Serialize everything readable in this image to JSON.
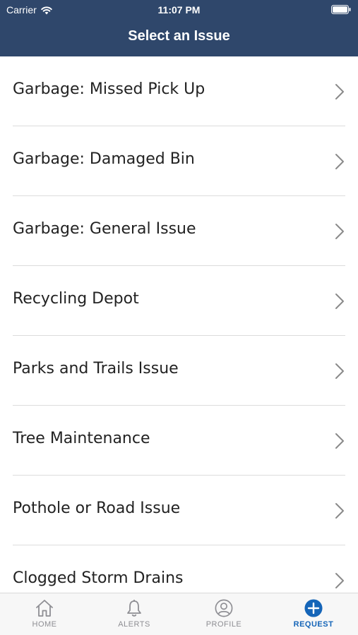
{
  "status_bar": {
    "carrier": "Carrier",
    "time": "11:07 PM"
  },
  "header": {
    "title": "Select an Issue"
  },
  "issues": [
    {
      "label": "Garbage: Missed Pick Up",
      "icon": "chevron-right-icon"
    },
    {
      "label": "Garbage: Damaged Bin",
      "icon": "chevron-right-icon"
    },
    {
      "label": "Garbage: General Issue",
      "icon": "chevron-right-icon"
    },
    {
      "label": "Recycling Depot",
      "icon": "chevron-right-icon"
    },
    {
      "label": "Parks and Trails Issue",
      "icon": "chevron-right-icon"
    },
    {
      "label": "Tree Maintenance",
      "icon": "chevron-right-icon"
    },
    {
      "label": "Pothole or Road Issue",
      "icon": "chevron-right-icon"
    },
    {
      "label": "Clogged Storm Drains",
      "icon": "chevron-right-icon"
    }
  ],
  "tabbar": {
    "tabs": [
      {
        "label": "HOME",
        "icon": "home-icon"
      },
      {
        "label": "ALERTS",
        "icon": "bell-icon"
      },
      {
        "label": "PROFILE",
        "icon": "user-icon"
      },
      {
        "label": "REQUEST",
        "icon": "plus-circle-icon",
        "active": true
      }
    ]
  },
  "colors": {
    "header_bg": "#2f476b",
    "accent": "#1565b8",
    "inactive_tab": "#8e8e93"
  }
}
